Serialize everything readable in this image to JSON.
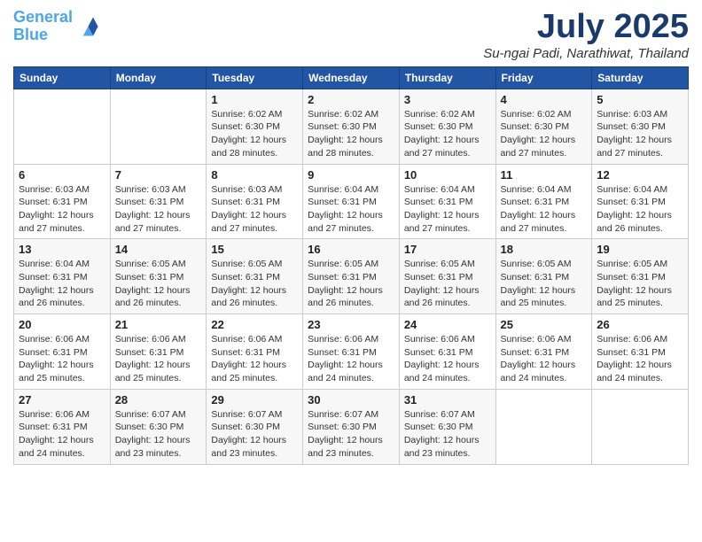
{
  "header": {
    "logo_line1": "General",
    "logo_line2": "Blue",
    "title": "July 2025",
    "subtitle": "Su-ngai Padi, Narathiwat, Thailand"
  },
  "weekdays": [
    "Sunday",
    "Monday",
    "Tuesday",
    "Wednesday",
    "Thursday",
    "Friday",
    "Saturday"
  ],
  "weeks": [
    [
      {
        "day": "",
        "info": ""
      },
      {
        "day": "",
        "info": ""
      },
      {
        "day": "1",
        "info": "Sunrise: 6:02 AM\nSunset: 6:30 PM\nDaylight: 12 hours and 28 minutes."
      },
      {
        "day": "2",
        "info": "Sunrise: 6:02 AM\nSunset: 6:30 PM\nDaylight: 12 hours and 28 minutes."
      },
      {
        "day": "3",
        "info": "Sunrise: 6:02 AM\nSunset: 6:30 PM\nDaylight: 12 hours and 27 minutes."
      },
      {
        "day": "4",
        "info": "Sunrise: 6:02 AM\nSunset: 6:30 PM\nDaylight: 12 hours and 27 minutes."
      },
      {
        "day": "5",
        "info": "Sunrise: 6:03 AM\nSunset: 6:30 PM\nDaylight: 12 hours and 27 minutes."
      }
    ],
    [
      {
        "day": "6",
        "info": "Sunrise: 6:03 AM\nSunset: 6:31 PM\nDaylight: 12 hours and 27 minutes."
      },
      {
        "day": "7",
        "info": "Sunrise: 6:03 AM\nSunset: 6:31 PM\nDaylight: 12 hours and 27 minutes."
      },
      {
        "day": "8",
        "info": "Sunrise: 6:03 AM\nSunset: 6:31 PM\nDaylight: 12 hours and 27 minutes."
      },
      {
        "day": "9",
        "info": "Sunrise: 6:04 AM\nSunset: 6:31 PM\nDaylight: 12 hours and 27 minutes."
      },
      {
        "day": "10",
        "info": "Sunrise: 6:04 AM\nSunset: 6:31 PM\nDaylight: 12 hours and 27 minutes."
      },
      {
        "day": "11",
        "info": "Sunrise: 6:04 AM\nSunset: 6:31 PM\nDaylight: 12 hours and 27 minutes."
      },
      {
        "day": "12",
        "info": "Sunrise: 6:04 AM\nSunset: 6:31 PM\nDaylight: 12 hours and 26 minutes."
      }
    ],
    [
      {
        "day": "13",
        "info": "Sunrise: 6:04 AM\nSunset: 6:31 PM\nDaylight: 12 hours and 26 minutes."
      },
      {
        "day": "14",
        "info": "Sunrise: 6:05 AM\nSunset: 6:31 PM\nDaylight: 12 hours and 26 minutes."
      },
      {
        "day": "15",
        "info": "Sunrise: 6:05 AM\nSunset: 6:31 PM\nDaylight: 12 hours and 26 minutes."
      },
      {
        "day": "16",
        "info": "Sunrise: 6:05 AM\nSunset: 6:31 PM\nDaylight: 12 hours and 26 minutes."
      },
      {
        "day": "17",
        "info": "Sunrise: 6:05 AM\nSunset: 6:31 PM\nDaylight: 12 hours and 26 minutes."
      },
      {
        "day": "18",
        "info": "Sunrise: 6:05 AM\nSunset: 6:31 PM\nDaylight: 12 hours and 25 minutes."
      },
      {
        "day": "19",
        "info": "Sunrise: 6:05 AM\nSunset: 6:31 PM\nDaylight: 12 hours and 25 minutes."
      }
    ],
    [
      {
        "day": "20",
        "info": "Sunrise: 6:06 AM\nSunset: 6:31 PM\nDaylight: 12 hours and 25 minutes."
      },
      {
        "day": "21",
        "info": "Sunrise: 6:06 AM\nSunset: 6:31 PM\nDaylight: 12 hours and 25 minutes."
      },
      {
        "day": "22",
        "info": "Sunrise: 6:06 AM\nSunset: 6:31 PM\nDaylight: 12 hours and 25 minutes."
      },
      {
        "day": "23",
        "info": "Sunrise: 6:06 AM\nSunset: 6:31 PM\nDaylight: 12 hours and 24 minutes."
      },
      {
        "day": "24",
        "info": "Sunrise: 6:06 AM\nSunset: 6:31 PM\nDaylight: 12 hours and 24 minutes."
      },
      {
        "day": "25",
        "info": "Sunrise: 6:06 AM\nSunset: 6:31 PM\nDaylight: 12 hours and 24 minutes."
      },
      {
        "day": "26",
        "info": "Sunrise: 6:06 AM\nSunset: 6:31 PM\nDaylight: 12 hours and 24 minutes."
      }
    ],
    [
      {
        "day": "27",
        "info": "Sunrise: 6:06 AM\nSunset: 6:31 PM\nDaylight: 12 hours and 24 minutes."
      },
      {
        "day": "28",
        "info": "Sunrise: 6:07 AM\nSunset: 6:30 PM\nDaylight: 12 hours and 23 minutes."
      },
      {
        "day": "29",
        "info": "Sunrise: 6:07 AM\nSunset: 6:30 PM\nDaylight: 12 hours and 23 minutes."
      },
      {
        "day": "30",
        "info": "Sunrise: 6:07 AM\nSunset: 6:30 PM\nDaylight: 12 hours and 23 minutes."
      },
      {
        "day": "31",
        "info": "Sunrise: 6:07 AM\nSunset: 6:30 PM\nDaylight: 12 hours and 23 minutes."
      },
      {
        "day": "",
        "info": ""
      },
      {
        "day": "",
        "info": ""
      }
    ]
  ]
}
